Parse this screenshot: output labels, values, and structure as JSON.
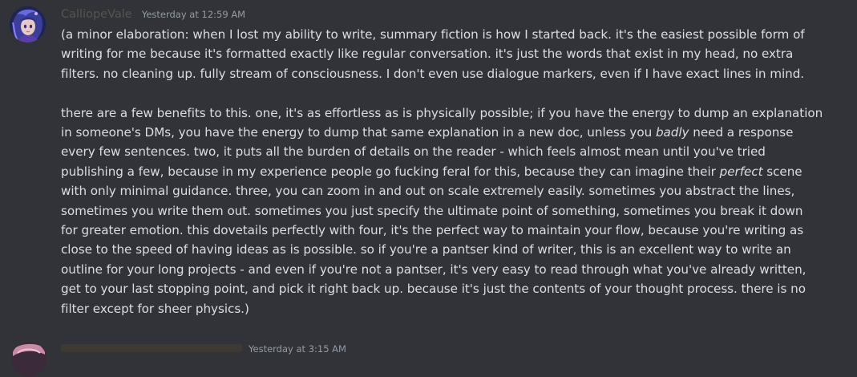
{
  "message": {
    "author": {
      "username": "CalliopeVale",
      "avatar_icon": "anime-character-avatar-icon"
    },
    "timestamp": "Yesterday at 12:59 AM",
    "paragraphs": [
      {
        "lines": [
          [
            "(a minor elaboration: when I lost my ability to write, summary fiction is how I started back. it's the easiest possible form of"
          ],
          [
            "writing for me because it's formatted exactly like regular conversation. it's just the words that exist in my head, no extra"
          ],
          [
            "filters. no cleaning up. fully stream of consciousness. I don't even use dialogue markers, even if I have exact lines in mind."
          ]
        ]
      },
      {
        "lines": [
          [
            "there are a few benefits to this. one, it's as effortless as is physically possible; if you have the energy to dump an explanation"
          ],
          [
            "in someone's DMs, you have the energy to dump that same explanation in a new doc, unless you ",
            "badly",
            " need a response"
          ],
          [
            "every few sentences. two, it puts all the burden of details on the reader - which feels almost mean until you've tried"
          ],
          [
            "publishing a few, because in my experience people go fucking feral for this, because they can imagine their ",
            "perfect",
            " scene"
          ],
          [
            "with only minimal guidance. three, you can zoom in and out on scale extremely easily. sometimes you abstract the lines,"
          ],
          [
            "sometimes you write them out. sometimes you just specify the ultimate point of something, sometimes you break it down"
          ],
          [
            "for greater emotion. this dovetails perfectly with four, it's the perfect way to maintain your flow, because you're writing as"
          ],
          [
            "close to the speed of having ideas as is possible. so if you're a pantser kind of writer, this is an excellent way to write an"
          ],
          [
            "outline for your long projects - and even if you're not a pantser, it's very easy to read through what you've already written,"
          ],
          [
            "get to your last stopping point, and pick it right back up. because it's just the contents of your thought process. there is no"
          ],
          [
            "filter except for sheer physics.)"
          ]
        ]
      }
    ]
  },
  "next_message": {
    "timestamp": "Yesterday at 3:15 AM"
  },
  "colors": {
    "background": "#313338",
    "text": "#dbdee1",
    "username": "#51584a",
    "timestamp": "#949ba4"
  }
}
